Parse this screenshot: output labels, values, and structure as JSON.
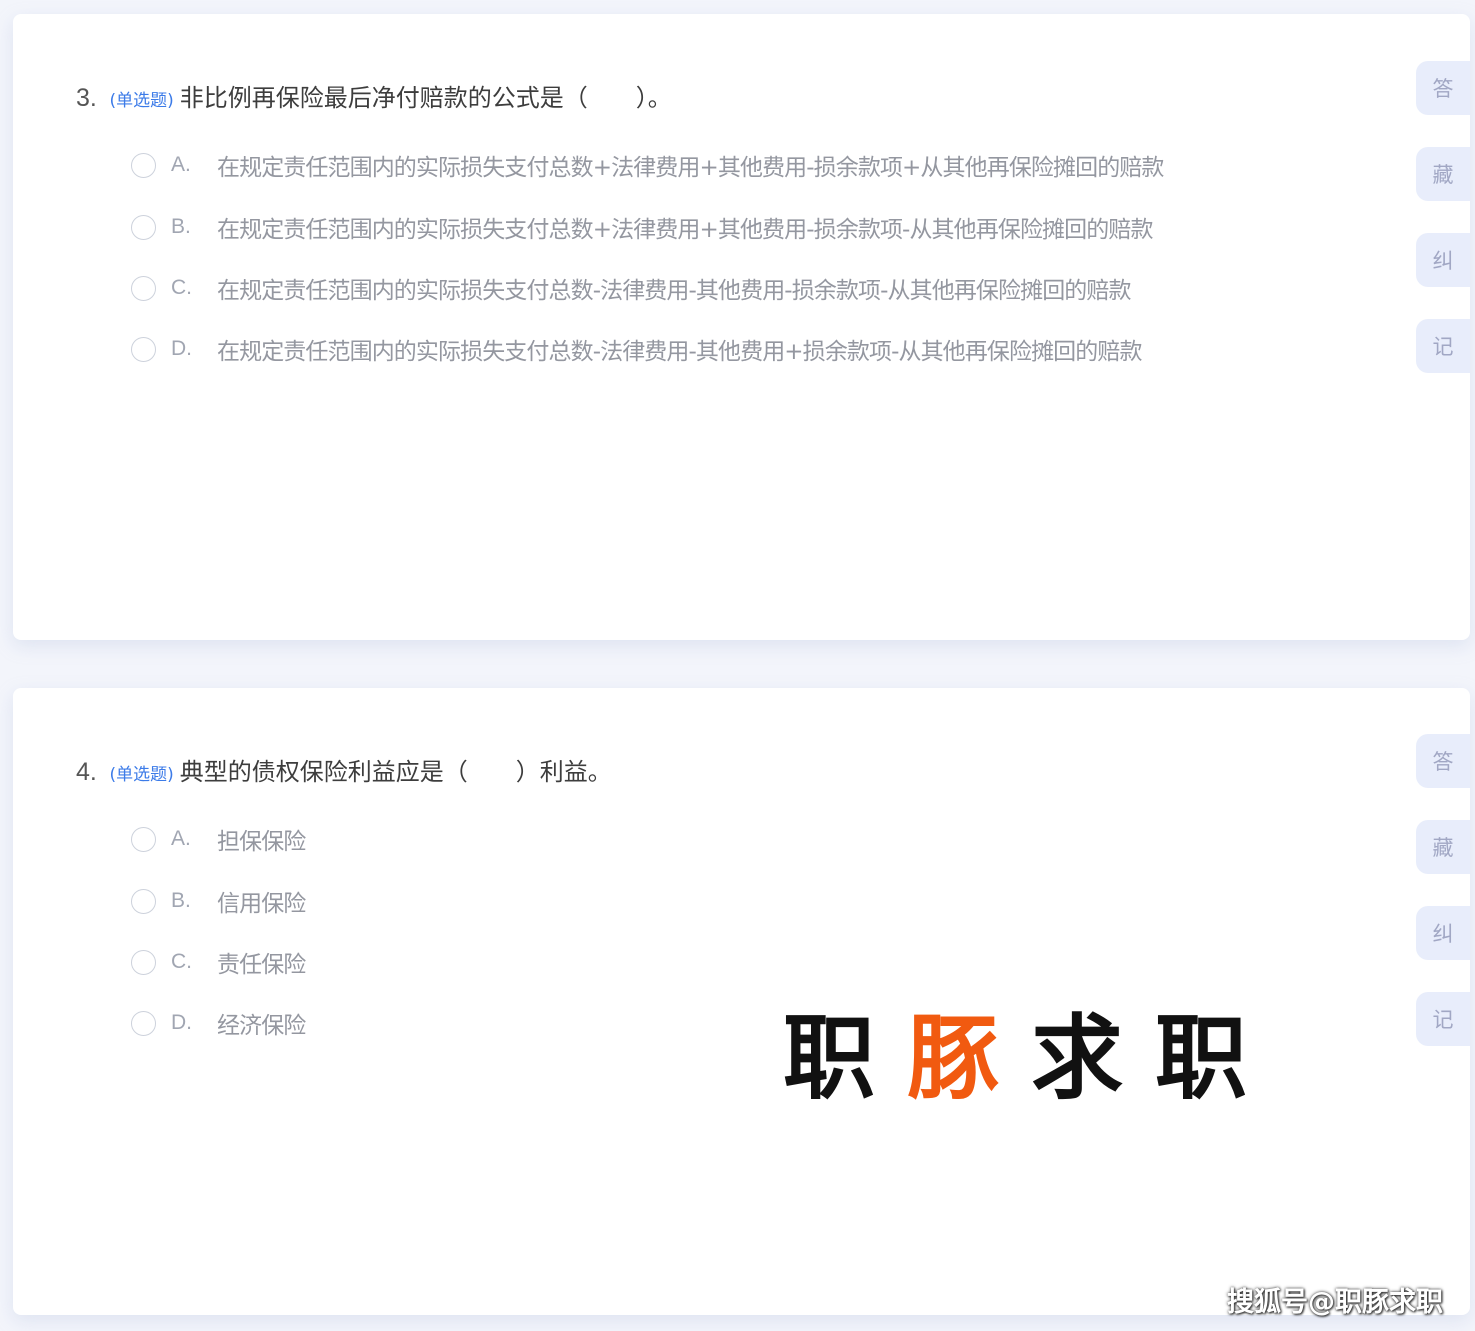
{
  "questions": [
    {
      "number": "3.",
      "type": "(单选题)",
      "stem": "非比例再保险最后净付赔款的公式是（　　）。",
      "options": [
        {
          "letter": "A.",
          "text": "在规定责任范围内的实际损失支付总数+法律费用+其他费用-损余款项+从其他再保险摊回的赔款"
        },
        {
          "letter": "B.",
          "text": "在规定责任范围内的实际损失支付总数+法律费用+其他费用-损余款项-从其他再保险摊回的赔款"
        },
        {
          "letter": "C.",
          "text": "在规定责任范围内的实际损失支付总数-法律费用-其他费用-损余款项-从其他再保险摊回的赔款"
        },
        {
          "letter": "D.",
          "text": "在规定责任范围内的实际损失支付总数-法律费用-其他费用+损余款项-从其他再保险摊回的赔款"
        }
      ],
      "side_buttons": [
        "答",
        "藏",
        "纠",
        "记"
      ]
    },
    {
      "number": "4.",
      "type": "(单选题)",
      "stem": "典型的债权保险利益应是（　　）利益。",
      "options": [
        {
          "letter": "A.",
          "text": "担保保险"
        },
        {
          "letter": "B.",
          "text": "信用保险"
        },
        {
          "letter": "C.",
          "text": "责任保险"
        },
        {
          "letter": "D.",
          "text": "经济保险"
        }
      ],
      "side_buttons": [
        "答",
        "藏",
        "纠",
        "记"
      ]
    }
  ],
  "watermark": {
    "logo_chars": [
      "职",
      "豚",
      "求",
      "职"
    ],
    "sohu": "搜狐号@职豚求职"
  },
  "colors": {
    "page_bg": "#f3f5fb",
    "accent_type_label": "#3c7be8",
    "side_button_bg": "#e8edfb",
    "logo_orange": "#f15a10"
  }
}
